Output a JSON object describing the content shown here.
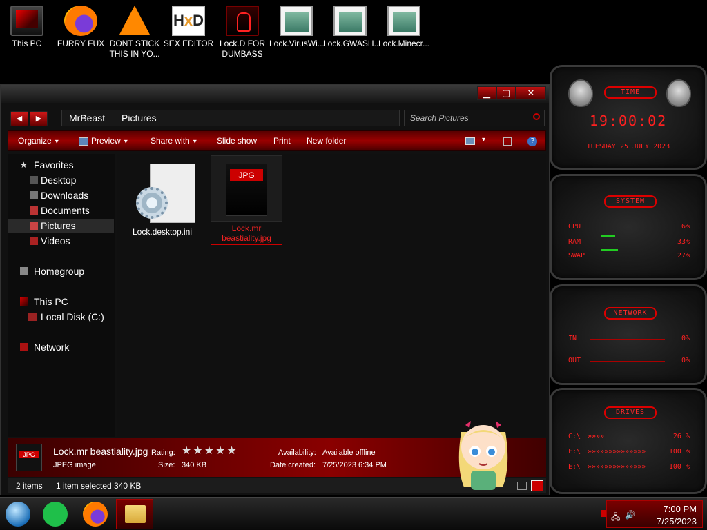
{
  "desktop_icons": [
    {
      "label": "This PC",
      "icon": "computer-icon"
    },
    {
      "label": "FURRY FUX",
      "icon": "firefox-icon"
    },
    {
      "label": "DONT STICK THIS IN YO...",
      "icon": "vlc-icon"
    },
    {
      "label": "SEX EDITOR",
      "icon": "hxd-icon"
    },
    {
      "label": "Lock.D FOR DUMBASS",
      "icon": "lock-icon"
    },
    {
      "label": "Lock.VirusWi...",
      "icon": "window-icon"
    },
    {
      "label": "Lock.GWASH...",
      "icon": "window-icon"
    },
    {
      "label": "Lock.Minecr...",
      "icon": "window-icon"
    }
  ],
  "explorer": {
    "breadcrumb": [
      "MrBeast",
      "Pictures"
    ],
    "search_placeholder": "Search Pictures",
    "toolbar": {
      "organize": "Organize",
      "preview": "Preview",
      "share_with": "Share with",
      "slide_show": "Slide show",
      "print": "Print",
      "new_folder": "New folder"
    },
    "nav": {
      "favorites": "Favorites",
      "desktop": "Desktop",
      "downloads": "Downloads",
      "documents": "Documents",
      "pictures": "Pictures",
      "videos": "Videos",
      "homegroup": "Homegroup",
      "this_pc": "This PC",
      "local_disk": "Local Disk (C:)",
      "network": "Network"
    },
    "files": [
      {
        "name": "Lock.desktop.ini",
        "type": "config"
      },
      {
        "name": "Lock.mr beastiality.jpg",
        "type": "jpg",
        "thumb_label": "JPG",
        "selected": true
      }
    ],
    "details": {
      "file_name": "Lock.mr beastiality.jpg",
      "file_type": "JPEG image",
      "thumb_label": "JPG",
      "rating_label": "Rating:",
      "rating_stars": "★★★★★",
      "rating_value": 0,
      "size_label": "Size:",
      "size_value": "340 KB",
      "availability_label": "Availability:",
      "availability_value": "Available offline",
      "date_label": "Date created:",
      "date_value": "7/25/2023 6:34 PM"
    },
    "status": {
      "items": "2 items",
      "selected": "1 item selected  340 KB"
    }
  },
  "gadgets": {
    "time": {
      "title": "TIME",
      "clock": "19:00:02",
      "date": "TUESDAY 25 JULY 2023"
    },
    "system": {
      "title": "SYSTEM",
      "rows": [
        {
          "label": "CPU",
          "value": "6%"
        },
        {
          "label": "RAM",
          "value": "33%"
        },
        {
          "label": "SWAP",
          "value": "27%"
        }
      ]
    },
    "network": {
      "title": "NETWORK",
      "rows": [
        {
          "label": "IN",
          "value": "0%"
        },
        {
          "label": "OUT",
          "value": "0%"
        }
      ]
    },
    "drives": {
      "title": "DRIVES",
      "rows": [
        {
          "label": "C:\\",
          "value": "26 %"
        },
        {
          "label": "F:\\",
          "value": "100 %"
        },
        {
          "label": "E:\\",
          "value": "100 %"
        }
      ]
    }
  },
  "taskbar": {
    "time": "7:00 PM",
    "date": "7/25/2023"
  },
  "colors": {
    "accent_red": "#d00000",
    "gadget_text": "#ff2020",
    "green_meter": "#22cc22"
  }
}
